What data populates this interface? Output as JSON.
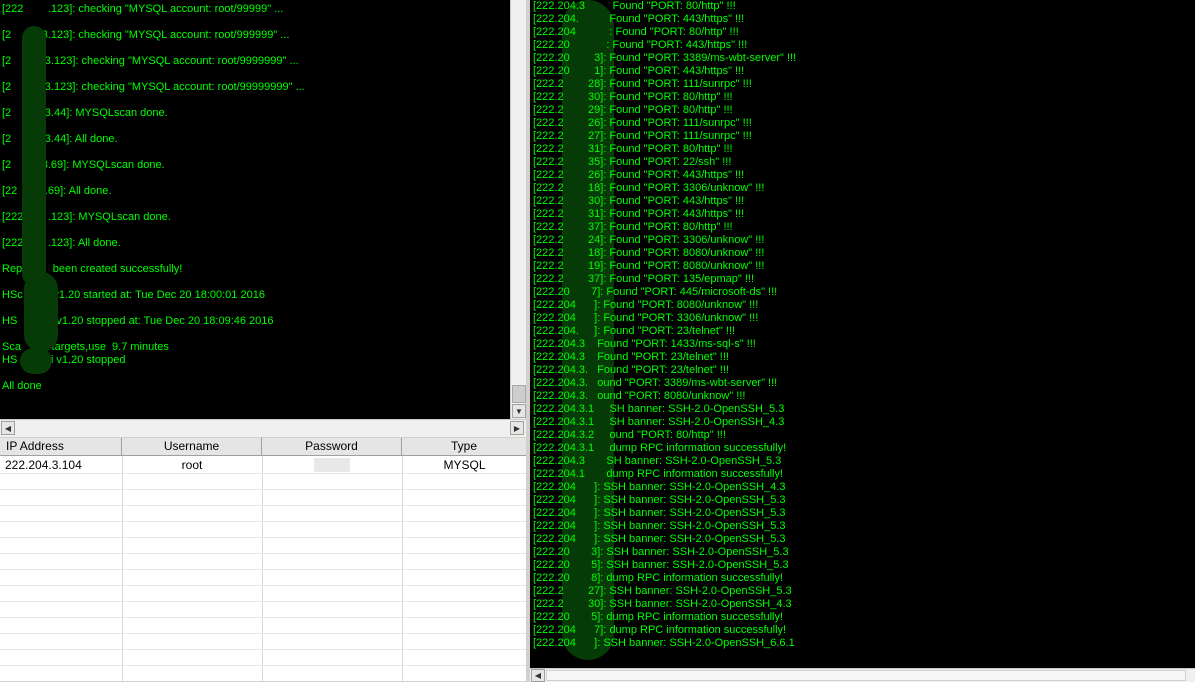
{
  "left_log": {
    "lines": [
      "[222        .123]: checking \"MYSQL account: root/99999\" ...",
      "[2          3.123]: checking \"MYSQL account: root/999999\" ...",
      "[2          .3.123]: checking \"MYSQL account: root/9999999\" ...",
      "[2          .3.123]: checking \"MYSQL account: root/99999999\" ...",
      "[2          .3.44]: MYSQLscan done.",
      "[2          .3.44]: All done.",
      "[2          3.69]: MYSQLscan done.",
      "[22         .69]: All done.",
      "[222        .123]: MYSQLscan done.",
      "[222        .123]: All done.",
      "Rep          been created successfully!",
      "HSc          v1.20 started at: Tue Dec 20 18:00:01 2016",
      "HS           i v1.20 stopped at: Tue Dec 20 18:09:46 2016",
      "Sca          targets,use  9.7 minutes",
      "HS           i v1.20 stopped",
      "All done"
    ]
  },
  "results_table": {
    "columns": [
      "IP Address",
      "Username",
      "Password",
      "Type"
    ],
    "rows": [
      {
        "ip": "222.204.3.104",
        "username": "root",
        "password": "",
        "type": "MYSQL"
      }
    ]
  },
  "right_log": {
    "lines": [
      "[222.204.3         Found \"PORT: 80/http\" !!!",
      "[222.204.          Found \"PORT: 443/https\" !!!",
      "[222.204           : Found \"PORT: 80/http\" !!!",
      "[222.20            : Found \"PORT: 443/https\" !!!",
      "[222.20        3]: Found \"PORT: 3389/ms-wbt-server\" !!!",
      "[222.20        1]: Found \"PORT: 443/https\" !!!",
      "[222.2        28]: Found \"PORT: 111/sunrpc\" !!!",
      "[222.2        30]: Found \"PORT: 80/http\" !!!",
      "[222.2        29]: Found \"PORT: 80/http\" !!!",
      "[222.2        26]: Found \"PORT: 111/sunrpc\" !!!",
      "[222.2        27]: Found \"PORT: 111/sunrpc\" !!!",
      "[222.2        31]: Found \"PORT: 80/http\" !!!",
      "[222.2        35]: Found \"PORT: 22/ssh\" !!!",
      "[222.2        26]: Found \"PORT: 443/https\" !!!",
      "[222.2        18]: Found \"PORT: 3306/unknow\" !!!",
      "[222.2        30]: Found \"PORT: 443/https\" !!!",
      "[222.2        31]: Found \"PORT: 443/https\" !!!",
      "[222.2        37]: Found \"PORT: 80/http\" !!!",
      "[222.2        24]: Found \"PORT: 3306/unknow\" !!!",
      "[222.2        18]: Found \"PORT: 8080/unknow\" !!!",
      "[222.2        19]: Found \"PORT: 8080/unknow\" !!!",
      "[222.2        37]: Found \"PORT: 135/epmap\" !!!",
      "[222.20       7]: Found \"PORT: 445/microsoft-ds\" !!!",
      "[222.204      ]: Found \"PORT: 8080/unknow\" !!!",
      "[222.204      ]: Found \"PORT: 3306/unknow\" !!!",
      "[222.204.     ]: Found \"PORT: 23/telnet\" !!!",
      "[222.204.3    Found \"PORT: 1433/ms-sql-s\" !!!",
      "[222.204.3    Found \"PORT: 23/telnet\" !!!",
      "[222.204.3.   Found \"PORT: 23/telnet\" !!!",
      "[222.204.3.   ound \"PORT: 3389/ms-wbt-server\" !!!",
      "[222.204.3.   ound \"PORT: 8080/unknow\" !!!",
      "[222.204.3.1     SH banner: SSH-2.0-OpenSSH_5.3",
      "[222.204.3.1     SH banner: SSH-2.0-OpenSSH_4.3",
      "[222.204.3.2     ound \"PORT: 80/http\" !!!",
      "[222.204.3.1     dump RPC information successfully!",
      "[222.204.3       SH banner: SSH-2.0-OpenSSH_5.3",
      "[222.204.1       dump RPC information successfully!",
      "[222.204      ]: SSH banner: SSH-2.0-OpenSSH_4.3",
      "[222.204      ]: SSH banner: SSH-2.0-OpenSSH_5.3",
      "[222.204      ]: SSH banner: SSH-2.0-OpenSSH_5.3",
      "[222.204      ]: SSH banner: SSH-2.0-OpenSSH_5.3",
      "[222.204      ]: SSH banner: SSH-2.0-OpenSSH_5.3",
      "[222.20       3]: SSH banner: SSH-2.0-OpenSSH_5.3",
      "[222.20       5]: SSH banner: SSH-2.0-OpenSSH_5.3",
      "[222.20       8]: dump RPC information successfully!",
      "[222.2        27]: SSH banner: SSH-2.0-OpenSSH_5.3",
      "[222.2        30]: SSH banner: SSH-2.0-OpenSSH_4.3",
      "[222.20       5]: dump RPC information successfully!",
      "[222.204      7]: dump RPC information successfully!",
      "[222.204      ]: SSH banner: SSH-2.0-OpenSSH_6.6.1"
    ]
  }
}
